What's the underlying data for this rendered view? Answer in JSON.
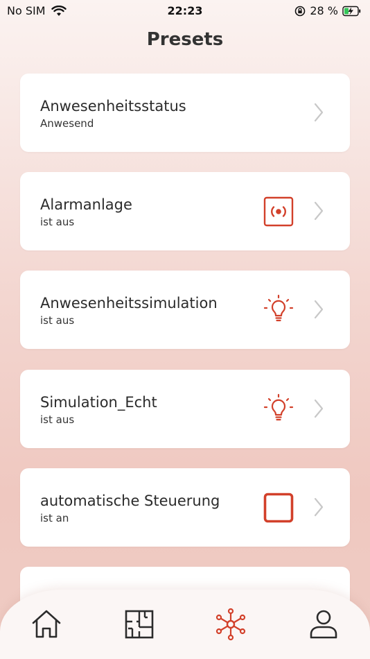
{
  "statusbar": {
    "carrier": "No SIM",
    "time": "22:23",
    "battery_percent": "28 %"
  },
  "header": {
    "title": "Presets"
  },
  "presets": [
    {
      "title": "Anwesenheitsstatus",
      "subtitle": "Anwesend",
      "icon": "none"
    },
    {
      "title": "Alarmanlage",
      "subtitle": "ist aus",
      "icon": "alarm-icon"
    },
    {
      "title": "Anwesenheitssimulation",
      "subtitle": "ist aus",
      "icon": "lightbulb-icon"
    },
    {
      "title": "Simulation_Echt",
      "subtitle": "ist aus",
      "icon": "lightbulb-icon"
    },
    {
      "title": "automatische Steuerung",
      "subtitle": "ist an",
      "icon": "square-icon"
    }
  ],
  "bottom_nav": [
    {
      "name": "home-icon"
    },
    {
      "name": "floorplan-icon"
    },
    {
      "name": "network-icon",
      "active": true
    },
    {
      "name": "user-icon"
    }
  ],
  "colors": {
    "accent": "#d2402a",
    "chevron": "#c8c8c8",
    "card_bg": "#ffffff",
    "nav_icon": "#2b2b2b"
  }
}
